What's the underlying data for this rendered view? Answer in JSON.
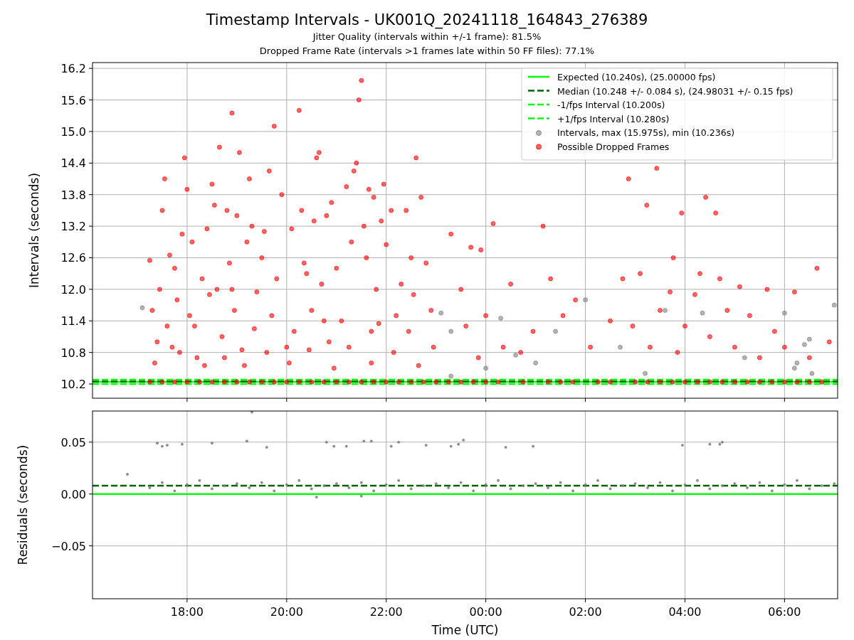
{
  "figure": {
    "title": "Timestamp Intervals - UK001Q_20241118_164843_276389",
    "subtitles": [
      "Jitter Quality (intervals within +/-1 frame): 81.5%",
      "Dropped Frame Rate (intervals >1 frames late within 50 FF files): 77.1%"
    ]
  },
  "intervals_plot": {
    "chart_data": {
      "type": "scatter",
      "ylabel": "Intervals (seconds)",
      "xlim": [
        "2024-11-18T16:06",
        "2024-11-19T07:04"
      ],
      "ylim": [
        9.93,
        16.31
      ],
      "yticks": [
        {
          "value": 10.2,
          "label": "10.2"
        },
        {
          "value": 10.8,
          "label": "10.8"
        },
        {
          "value": 11.4,
          "label": "11.4"
        },
        {
          "value": 12.0,
          "label": "12.0"
        },
        {
          "value": 12.6,
          "label": "12.6"
        },
        {
          "value": 13.2,
          "label": "13.2"
        },
        {
          "value": 13.8,
          "label": "13.8"
        },
        {
          "value": 14.4,
          "label": "14.4"
        },
        {
          "value": 15.0,
          "label": "15.0"
        },
        {
          "value": 15.6,
          "label": "15.6"
        },
        {
          "value": 16.2,
          "label": "16.2"
        }
      ],
      "ref_lines": [
        {
          "axis": "y",
          "value": 10.24,
          "label": "Expected (10.240s), (25.00000 fps)",
          "color": "#00ff00"
        },
        {
          "axis": "y",
          "value": 10.248,
          "label": "Median (10.248 +/- 0.084 s), (24.98031 +/- 0.15 fps)",
          "color": "#006400"
        },
        {
          "axis": "y",
          "value": 10.2,
          "label": "-1/fps Interval (10.200s)",
          "color": "#00ff00"
        },
        {
          "axis": "y",
          "value": 10.28,
          "label": "+1/fps Interval (10.280s)",
          "color": "#00ff00"
        }
      ],
      "grid": true,
      "legend": true,
      "series": [
        {
          "name": "Intervals, max (15.975s), min (10.236s)",
          "color": "#808080",
          "x": [
            "2024-11-18T17:06",
            "2024-11-18T23:06",
            "2024-11-18T23:18",
            "2024-11-18T23:18",
            "2024-11-19T00:18",
            "2024-11-19T00:36",
            "2024-11-19T01:00",
            "2024-11-19T01:24",
            "2024-11-19T02:00",
            "2024-11-19T02:42",
            "2024-11-19T03:12",
            "2024-11-19T03:36",
            "2024-11-19T04:21",
            "2024-11-19T05:12",
            "2024-11-19T06:00",
            "2024-11-19T06:12",
            "2024-11-19T06:24",
            "2024-11-19T06:30",
            "2024-11-19T06:33",
            "2024-11-19T07:00",
            "2024-11-19T06:15",
            "2024-11-19T00:00"
          ],
          "values": [
            11.65,
            11.55,
            11.2,
            10.35,
            11.45,
            10.75,
            10.6,
            11.2,
            11.8,
            10.9,
            10.4,
            11.6,
            11.55,
            10.7,
            11.55,
            10.5,
            10.95,
            11.05,
            10.4,
            11.7,
            10.6,
            10.5
          ]
        },
        {
          "name": "Possible Dropped Frames",
          "color": "#ff0000",
          "x": [
            "2024-11-18T17:15",
            "2024-11-18T17:18",
            "2024-11-18T17:21",
            "2024-11-18T17:27",
            "2024-11-18T17:30",
            "2024-11-18T17:33",
            "2024-11-18T17:36",
            "2024-11-18T17:39",
            "2024-11-18T17:42",
            "2024-11-18T17:45",
            "2024-11-18T17:48",
            "2024-11-18T17:54",
            "2024-11-18T17:57",
            "2024-11-18T18:00",
            "2024-11-18T18:03",
            "2024-11-18T18:06",
            "2024-11-18T18:12",
            "2024-11-18T18:18",
            "2024-11-18T18:24",
            "2024-11-18T18:27",
            "2024-11-18T18:30",
            "2024-11-18T18:33",
            "2024-11-18T18:36",
            "2024-11-18T18:39",
            "2024-11-18T18:42",
            "2024-11-18T18:48",
            "2024-11-18T18:51",
            "2024-11-18T18:54",
            "2024-11-18T18:57",
            "2024-11-18T19:00",
            "2024-11-18T19:03",
            "2024-11-18T19:06",
            "2024-11-18T19:12",
            "2024-11-18T19:15",
            "2024-11-18T19:18",
            "2024-11-18T19:24",
            "2024-11-18T19:30",
            "2024-11-18T19:33",
            "2024-11-18T19:39",
            "2024-11-18T19:42",
            "2024-11-18T19:45",
            "2024-11-18T19:48",
            "2024-11-18T19:54",
            "2024-11-18T20:00",
            "2024-11-18T20:06",
            "2024-11-18T20:09",
            "2024-11-18T20:15",
            "2024-11-18T20:18",
            "2024-11-18T20:24",
            "2024-11-18T20:30",
            "2024-11-18T20:33",
            "2024-11-18T20:36",
            "2024-11-18T20:39",
            "2024-11-18T20:42",
            "2024-11-18T20:48",
            "2024-11-18T20:51",
            "2024-11-18T20:54",
            "2024-11-18T21:00",
            "2024-11-18T21:06",
            "2024-11-18T21:12",
            "2024-11-18T21:18",
            "2024-11-18T21:21",
            "2024-11-18T21:24",
            "2024-11-18T21:27",
            "2024-11-18T21:30",
            "2024-11-18T21:33",
            "2024-11-18T21:36",
            "2024-11-18T21:39",
            "2024-11-18T21:42",
            "2024-11-18T21:45",
            "2024-11-18T21:48",
            "2024-11-18T21:54",
            "2024-11-18T21:57",
            "2024-11-18T22:00",
            "2024-11-18T22:06",
            "2024-11-18T22:12",
            "2024-11-18T22:18",
            "2024-11-18T22:24",
            "2024-11-18T22:30",
            "2024-11-18T22:33",
            "2024-11-18T22:36",
            "2024-11-18T22:42",
            "2024-11-18T22:48",
            "2024-11-18T22:54",
            "2024-11-18T22:57",
            "2024-11-18T17:24",
            "2024-11-18T17:51",
            "2024-11-18T18:21",
            "2024-11-18T18:45",
            "2024-11-18T19:09",
            "2024-11-18T19:36",
            "2024-11-18T20:03",
            "2024-11-18T20:27",
            "2024-11-18T20:57",
            "2024-11-18T21:15",
            "2024-11-18T21:42",
            "2024-11-18T22:09",
            "2024-11-18T22:39",
            "2024-11-18T18:09",
            "2024-11-18T19:21",
            "2024-11-18T20:45",
            "2024-11-18T21:51",
            "2024-11-18T22:27",
            "2024-11-18T18:54",
            "2024-11-18T20:21",
            "2024-11-18T23:18",
            "2024-11-18T23:30",
            "2024-11-18T23:36",
            "2024-11-18T23:42",
            "2024-11-18T23:51",
            "2024-11-18T23:54",
            "2024-11-19T00:00",
            "2024-11-19T00:09",
            "2024-11-19T00:21",
            "2024-11-19T00:30",
            "2024-11-19T00:42",
            "2024-11-19T00:57",
            "2024-11-19T01:09",
            "2024-11-19T01:18",
            "2024-11-19T01:33",
            "2024-11-19T01:48",
            "2024-11-19T02:06",
            "2024-11-19T02:30",
            "2024-11-19T02:45",
            "2024-11-19T02:52",
            "2024-11-19T02:57",
            "2024-11-19T03:06",
            "2024-11-19T03:14",
            "2024-11-19T03:18",
            "2024-11-19T03:26",
            "2024-11-19T03:30",
            "2024-11-19T03:35",
            "2024-11-19T03:42",
            "2024-11-19T03:46",
            "2024-11-19T03:51",
            "2024-11-19T03:56",
            "2024-11-19T04:00",
            "2024-11-19T04:12",
            "2024-11-19T04:18",
            "2024-11-19T04:25",
            "2024-11-19T04:30",
            "2024-11-19T04:37",
            "2024-11-19T04:42",
            "2024-11-19T04:51",
            "2024-11-19T05:00",
            "2024-11-19T05:06",
            "2024-11-19T05:18",
            "2024-11-19T05:30",
            "2024-11-19T05:39",
            "2024-11-19T05:48",
            "2024-11-19T06:00",
            "2024-11-19T06:12",
            "2024-11-19T06:30",
            "2024-11-19T06:39",
            "2024-11-19T06:54",
            "2024-11-18T17:15",
            "2024-11-18T17:30",
            "2024-11-18T17:45",
            "2024-11-18T18:00",
            "2024-11-18T18:15",
            "2024-11-18T18:30",
            "2024-11-18T18:45",
            "2024-11-18T19:00",
            "2024-11-18T19:15",
            "2024-11-18T19:30",
            "2024-11-18T19:45",
            "2024-11-18T20:00",
            "2024-11-18T20:15",
            "2024-11-18T20:30",
            "2024-11-18T20:45",
            "2024-11-18T21:00",
            "2024-11-18T21:15",
            "2024-11-18T21:30",
            "2024-11-18T21:45",
            "2024-11-18T22:00",
            "2024-11-18T22:15",
            "2024-11-18T22:30",
            "2024-11-18T22:45",
            "2024-11-18T23:00",
            "2024-11-18T23:15",
            "2024-11-18T23:30",
            "2024-11-18T23:45",
            "2024-11-19T00:00",
            "2024-11-19T00:15",
            "2024-11-19T00:45",
            "2024-11-19T01:15",
            "2024-11-19T01:30",
            "2024-11-19T01:45",
            "2024-11-19T02:15",
            "2024-11-19T02:30",
            "2024-11-19T03:00",
            "2024-11-19T03:15",
            "2024-11-19T03:30",
            "2024-11-19T03:45",
            "2024-11-19T04:00",
            "2024-11-19T04:15",
            "2024-11-19T04:30",
            "2024-11-19T04:45",
            "2024-11-19T05:00",
            "2024-11-19T05:15",
            "2024-11-19T05:30",
            "2024-11-19T05:45",
            "2024-11-19T06:00",
            "2024-11-19T06:15",
            "2024-11-19T06:30",
            "2024-11-19T06:45"
          ],
          "values": [
            12.55,
            11.6,
            10.6,
            12.0,
            13.5,
            14.1,
            11.3,
            12.65,
            10.9,
            12.4,
            11.8,
            13.05,
            14.5,
            13.9,
            11.5,
            12.9,
            10.7,
            12.2,
            13.15,
            11.9,
            14.0,
            13.6,
            12.0,
            14.7,
            11.1,
            13.5,
            12.5,
            15.35,
            11.6,
            13.4,
            14.6,
            10.85,
            12.9,
            14.1,
            13.2,
            11.95,
            12.6,
            13.1,
            14.25,
            11.5,
            15.1,
            12.2,
            13.8,
            10.9,
            13.15,
            11.2,
            15.4,
            13.5,
            12.3,
            11.6,
            13.3,
            14.5,
            14.6,
            12.1,
            13.4,
            11.0,
            13.65,
            12.4,
            11.4,
            13.95,
            12.9,
            14.25,
            14.4,
            15.6,
            15.97,
            13.2,
            12.6,
            13.9,
            11.2,
            13.75,
            12.0,
            13.3,
            14.0,
            12.85,
            13.5,
            11.5,
            12.1,
            13.5,
            12.6,
            11.9,
            14.5,
            13.75,
            12.5,
            11.6,
            10.9,
            11.0,
            10.8,
            10.55,
            10.7,
            10.55,
            10.8,
            10.6,
            10.85,
            10.5,
            10.9,
            10.6,
            10.8,
            10.55,
            11.3,
            11.25,
            11.4,
            11.35,
            11.2,
            12.0,
            12.5,
            13.05,
            12.0,
            11.3,
            12.8,
            10.7,
            12.75,
            11.5,
            13.25,
            10.9,
            12.1,
            10.8,
            11.2,
            13.2,
            12.2,
            11.5,
            11.8,
            10.9,
            11.4,
            12.2,
            14.1,
            11.3,
            12.3,
            13.6,
            10.9,
            14.3,
            11.6,
            null,
            11.95,
            12.6,
            10.8,
            13.45,
            11.3,
            11.9,
            12.3,
            13.75,
            11.1,
            13.45,
            12.2,
            11.6,
            10.9,
            12.05,
            11.5,
            10.7,
            12.0,
            11.2,
            10.9,
            11.95,
            10.7,
            12.4,
            11.0,
            10.24,
            10.24,
            10.24,
            10.24,
            10.24,
            10.24,
            10.24,
            10.24,
            10.24,
            10.24,
            10.24,
            10.24,
            10.24,
            10.24,
            10.24,
            10.24,
            10.24,
            10.24,
            10.24,
            10.24,
            10.24,
            10.24,
            10.24,
            10.24,
            10.24,
            10.24,
            10.24,
            10.24,
            10.24,
            10.24,
            10.24,
            10.24,
            10.24,
            10.24,
            10.24,
            10.24,
            10.24,
            10.24,
            10.24,
            10.24,
            10.24,
            10.24,
            10.24,
            10.24,
            10.24,
            10.24,
            10.24,
            10.24,
            10.24,
            10.24,
            10.24
          ]
        }
      ]
    }
  },
  "residuals_plot": {
    "chart_data": {
      "type": "scatter",
      "ylabel": "Residuals (seconds)",
      "xlabel": "Time (UTC)",
      "xlim": [
        "2024-11-18T16:06",
        "2024-11-19T07:04"
      ],
      "ylim": [
        -0.101,
        0.08
      ],
      "xticks": [
        {
          "value": "2024-11-18T18:00",
          "label": "18:00"
        },
        {
          "value": "2024-11-18T20:00",
          "label": "20:00"
        },
        {
          "value": "2024-11-18T22:00",
          "label": "22:00"
        },
        {
          "value": "2024-11-19T00:00",
          "label": "00:00"
        },
        {
          "value": "2024-11-19T02:00",
          "label": "02:00"
        },
        {
          "value": "2024-11-19T04:00",
          "label": "04:00"
        },
        {
          "value": "2024-11-19T06:00",
          "label": "06:00"
        }
      ],
      "yticks": [
        {
          "value": -0.05,
          "label": "−0.05"
        },
        {
          "value": 0,
          "label": "0.00"
        },
        {
          "value": 0.05,
          "label": "0.05"
        }
      ],
      "ref_lines": [
        {
          "axis": "y",
          "value": 0,
          "color": "#00ff00"
        },
        {
          "axis": "y",
          "value": 0.008,
          "color": "#006400"
        }
      ],
      "grid": true,
      "series": [
        {
          "color": "#808080",
          "x": [
            "2024-11-18T17:15",
            "2024-11-18T17:30",
            "2024-11-18T17:45",
            "2024-11-18T18:00",
            "2024-11-18T18:15",
            "2024-11-18T18:30",
            "2024-11-18T18:45",
            "2024-11-18T19:00",
            "2024-11-18T19:15",
            "2024-11-18T19:30",
            "2024-11-18T19:45",
            "2024-11-18T20:00",
            "2024-11-18T20:15",
            "2024-11-18T20:30",
            "2024-11-18T20:45",
            "2024-11-18T21:00",
            "2024-11-18T21:15",
            "2024-11-18T21:30",
            "2024-11-18T21:45",
            "2024-11-18T22:00",
            "2024-11-18T22:15",
            "2024-11-18T22:30",
            "2024-11-18T22:45",
            "2024-11-18T23:00",
            "2024-11-18T23:15",
            "2024-11-18T23:30",
            "2024-11-18T23:45",
            "2024-11-19T00:00",
            "2024-11-19T00:15",
            "2024-11-19T00:30",
            "2024-11-19T00:45",
            "2024-11-19T01:00",
            "2024-11-19T01:15",
            "2024-11-19T01:30",
            "2024-11-19T01:45",
            "2024-11-19T02:00",
            "2024-11-19T02:15",
            "2024-11-19T02:30",
            "2024-11-19T02:45",
            "2024-11-19T03:00",
            "2024-11-19T03:15",
            "2024-11-19T03:30",
            "2024-11-19T03:45",
            "2024-11-19T04:00",
            "2024-11-19T04:15",
            "2024-11-19T04:30",
            "2024-11-19T04:45",
            "2024-11-19T05:00",
            "2024-11-19T05:15",
            "2024-11-19T05:30",
            "2024-11-19T05:45",
            "2024-11-19T06:00",
            "2024-11-19T06:15",
            "2024-11-19T06:30",
            "2024-11-19T06:45",
            "2024-11-19T07:00",
            "2024-11-18T17:24",
            "2024-11-18T17:30",
            "2024-11-18T17:36",
            "2024-11-18T17:54",
            "2024-11-18T18:30",
            "2024-11-18T19:12",
            "2024-11-18T19:36",
            "2024-11-18T20:48",
            "2024-11-18T20:57",
            "2024-11-18T21:12",
            "2024-11-18T21:33",
            "2024-11-18T21:42",
            "2024-11-18T22:06",
            "2024-11-18T22:15",
            "2024-11-18T22:48",
            "2024-11-18T23:18",
            "2024-11-18T23:27",
            "2024-11-18T23:33",
            "2024-11-19T00:24",
            "2024-11-19T00:57",
            "2024-11-19T03:57",
            "2024-11-19T04:30",
            "2024-11-19T04:42",
            "2024-11-19T04:45",
            "2024-11-18T16:48",
            "2024-11-18T19:18",
            "2024-11-18T21:30",
            "2024-11-18T20:36"
          ],
          "values": [
            0.006,
            0.011,
            0.003,
            0.009,
            0.013,
            0.005,
            0.008,
            0.01,
            0.006,
            0.011,
            0.003,
            0.009,
            0.013,
            0.005,
            0.008,
            0.01,
            0.006,
            0.011,
            0.003,
            0.009,
            0.013,
            0.005,
            0.008,
            0.01,
            0.006,
            0.011,
            0.003,
            0.009,
            0.013,
            0.005,
            0.008,
            0.01,
            0.006,
            0.011,
            0.003,
            0.009,
            0.013,
            0.005,
            0.008,
            0.01,
            0.006,
            0.011,
            0.003,
            0.009,
            0.013,
            0.005,
            0.008,
            0.01,
            0.006,
            0.011,
            0.003,
            0.009,
            0.013,
            0.005,
            0.008,
            0.01,
            0.049,
            0.046,
            0.047,
            0.048,
            0.049,
            0.051,
            0.045,
            0.05,
            0.046,
            0.046,
            0.051,
            0.051,
            0.046,
            0.05,
            0.047,
            0.046,
            0.048,
            0.052,
            0.045,
            0.046,
            0.047,
            0.048,
            0.048,
            0.05,
            0.019,
            0.079,
            -0.002,
            -0.003
          ]
        }
      ]
    }
  }
}
